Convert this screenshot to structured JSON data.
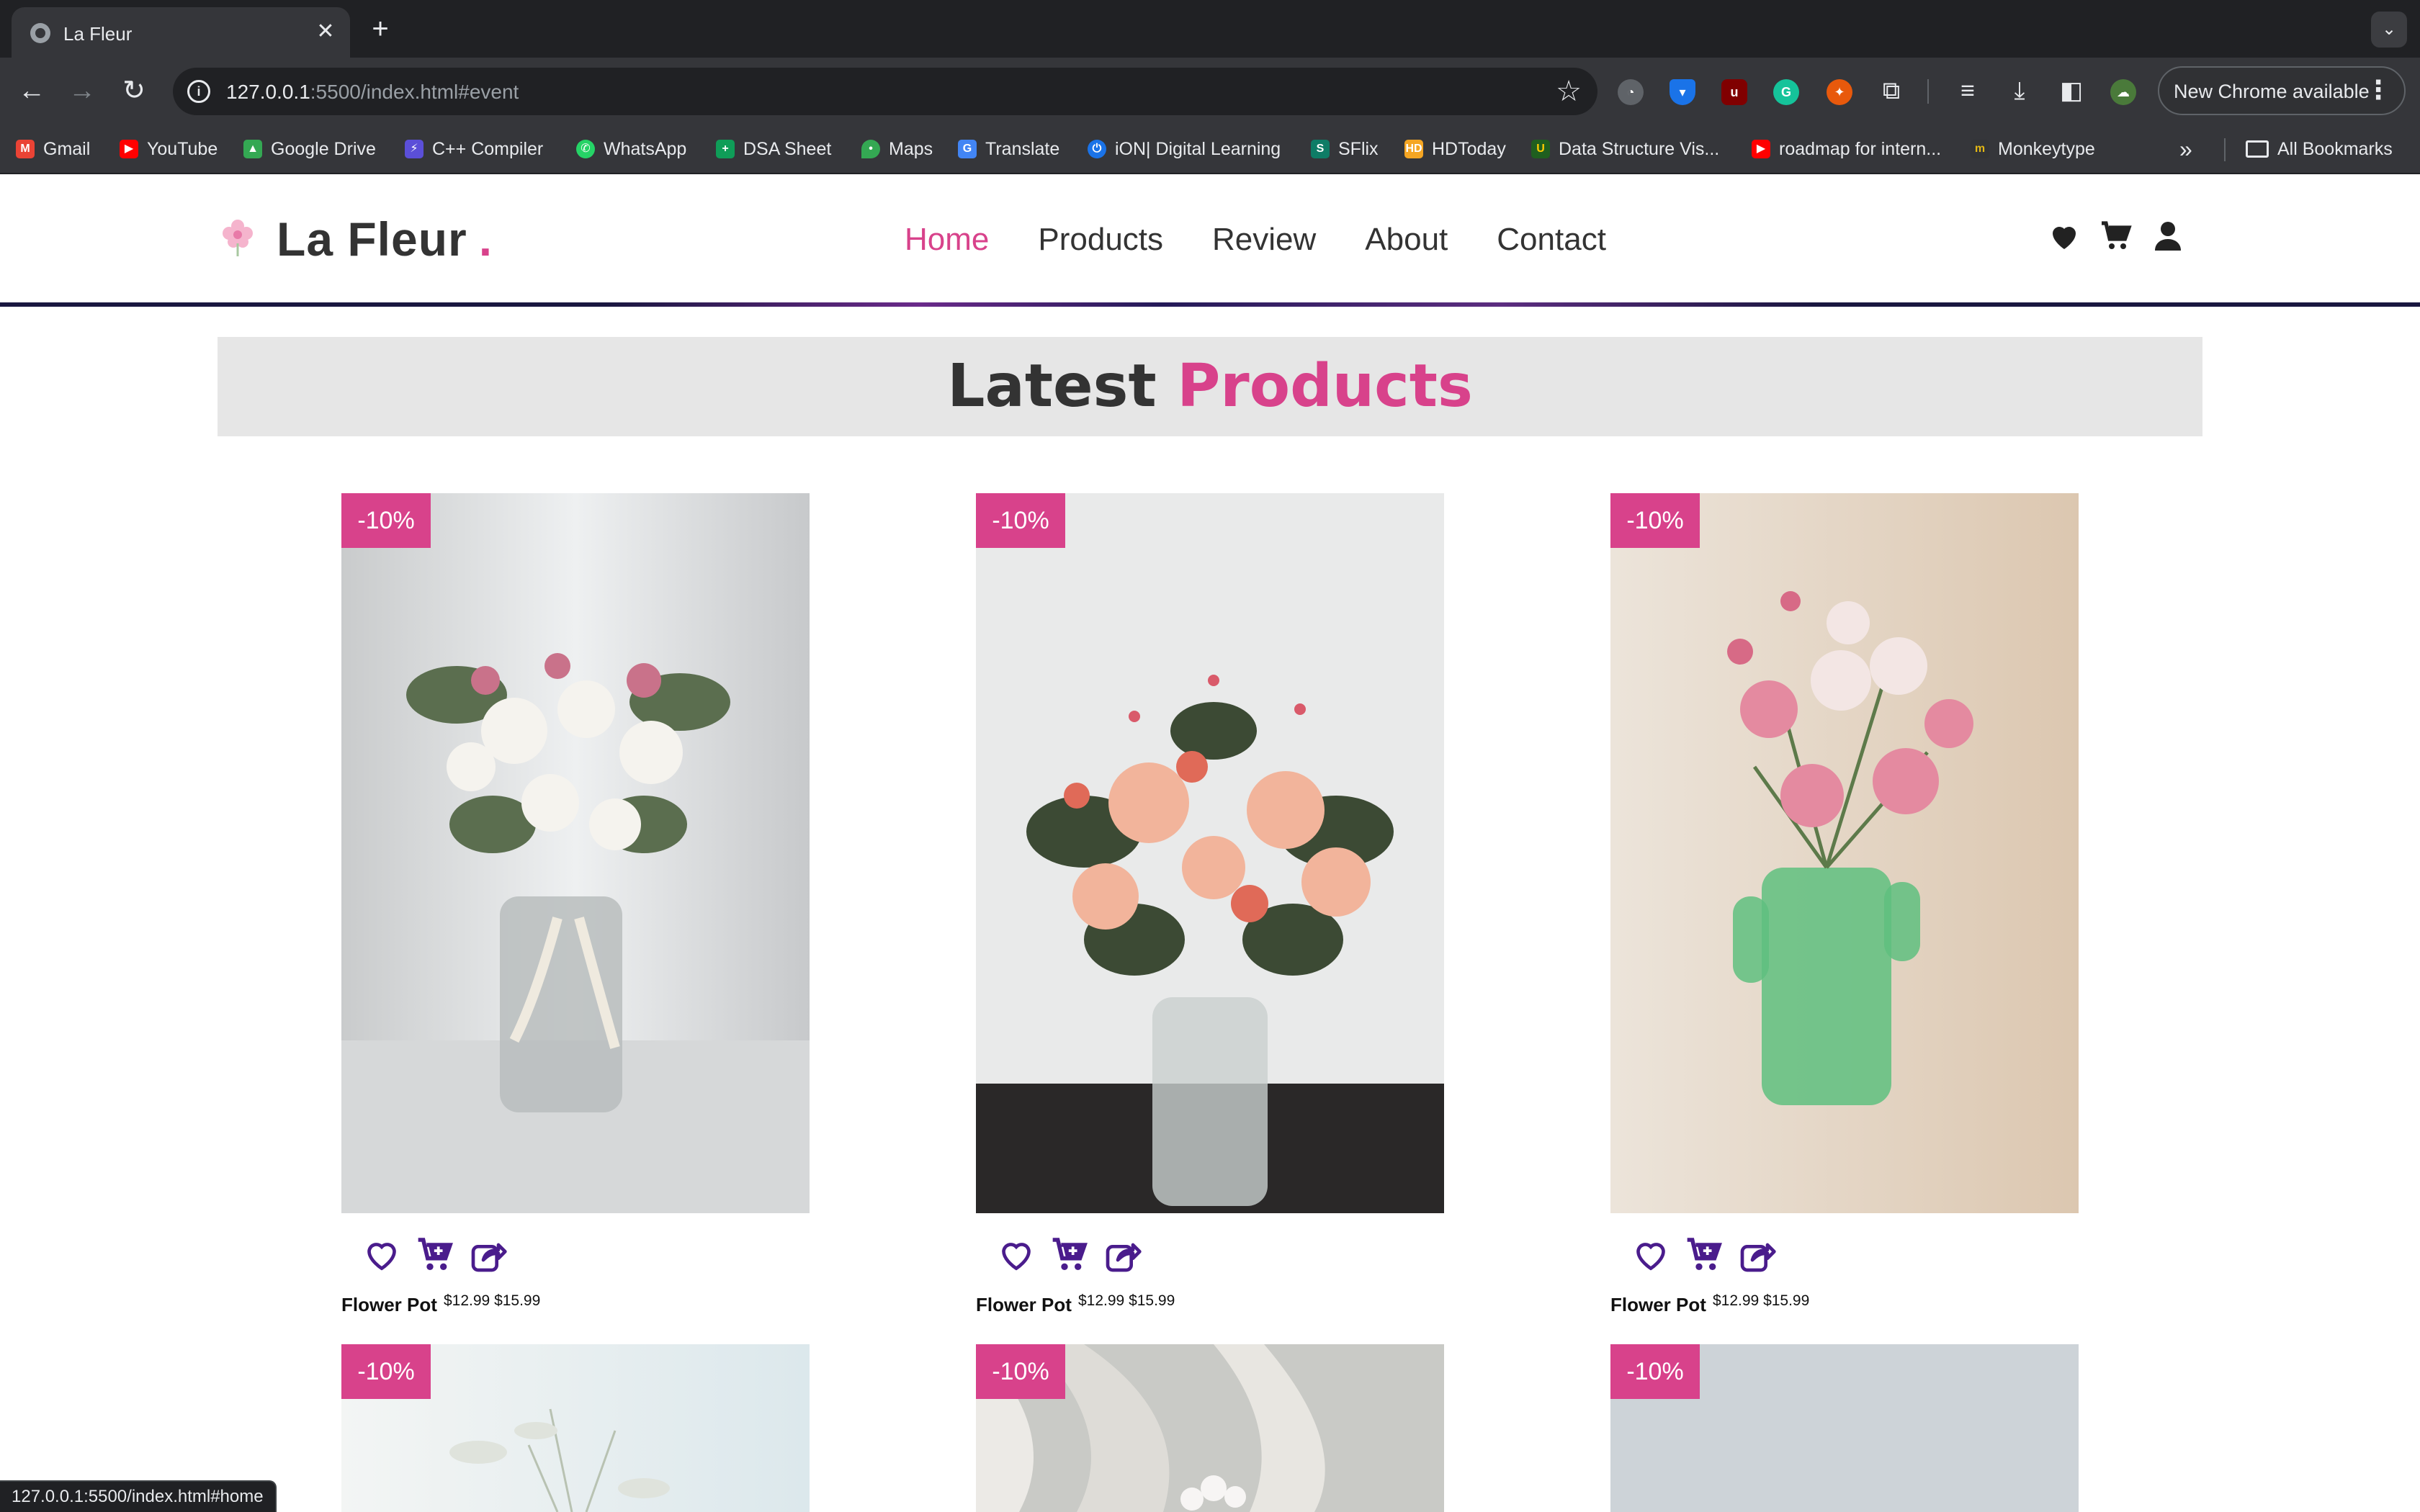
{
  "browser": {
    "tab_title": "La Fleur",
    "url_host": "127.0.0.1",
    "url_rest": ":5500/index.html#event",
    "update_label": "New Chrome available",
    "bookmarks": [
      "Gmail",
      "YouTube",
      "Google Drive",
      "C++ Compiler",
      "WhatsApp",
      "DSA Sheet",
      "Maps",
      "Translate",
      "iON| Digital Learning",
      "SFlix",
      "HDToday",
      "Data Structure Vis...",
      "roadmap for intern...",
      "Monkeytype"
    ],
    "all_bookmarks": "All Bookmarks",
    "status_url": "127.0.0.1:5500/index.html#home"
  },
  "site": {
    "logo": "La Fleur",
    "logo_dot": ".",
    "nav": [
      "Home",
      "Products",
      "Review",
      "About",
      "Contact"
    ],
    "active_nav": "Home",
    "accent_color": "#d8428b",
    "action_color": "#4a1c8c"
  },
  "section": {
    "title_dark": "Latest",
    "title_accent": "Products"
  },
  "products": [
    {
      "discount": "-10%",
      "name": "Flower Pot",
      "price": "$12.99 $15.99"
    },
    {
      "discount": "-10%",
      "name": "Flower Pot",
      "price": "$12.99 $15.99"
    },
    {
      "discount": "-10%",
      "name": "Flower Pot",
      "price": "$12.99 $15.99"
    },
    {
      "discount": "-10%"
    },
    {
      "discount": "-10%"
    },
    {
      "discount": "-10%"
    }
  ]
}
